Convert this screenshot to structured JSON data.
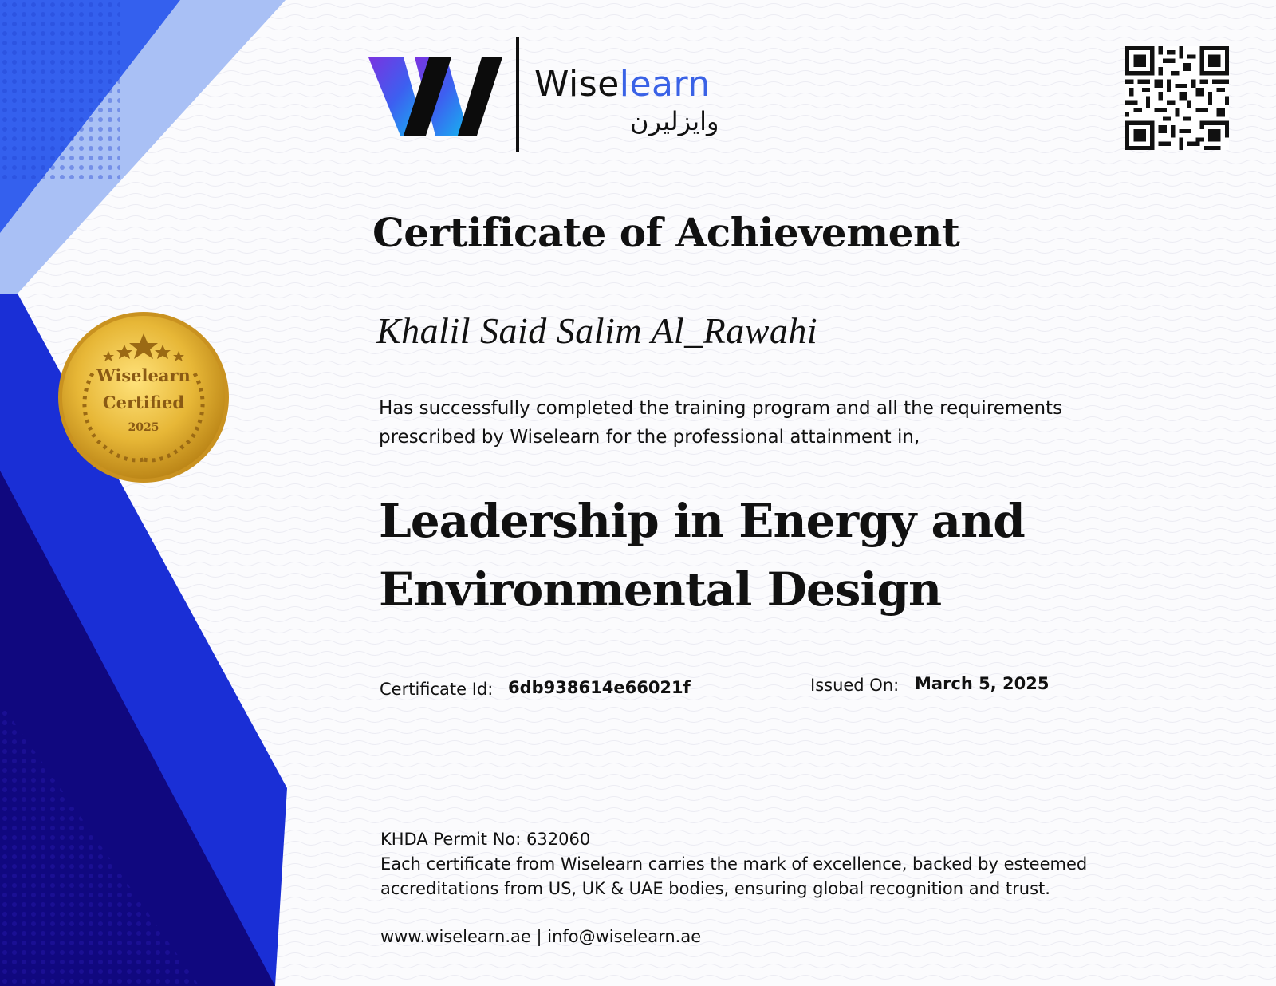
{
  "brand": {
    "name_part1": "Wise",
    "name_part2": "learn",
    "name_arabic": "وايزليرن"
  },
  "certificate": {
    "title": "Certificate of Achievement",
    "recipient": "Khalil Said Salim Al_Rawahi",
    "statement": "Has successfully completed the training program and all the requirements prescribed by Wiselearn for the professional attainment in,",
    "program_line1": "Leadership in Energy and",
    "program_line2": "Environmental Design",
    "id_label": "Certificate Id:",
    "id_value": "6db938614e66021f",
    "issued_label": "Issued On:",
    "issued_value": "March 5, 2025"
  },
  "seal": {
    "line1": "Wiselearn",
    "line2": "Certified",
    "year": "2025"
  },
  "footer": {
    "permit": "KHDA Permit No: 632060",
    "accreditation": "Each certificate from Wiselearn carries the mark of excellence, backed by esteemed accreditations from US, UK & UAE bodies, ensuring global recognition and trust.",
    "contact": "www.wiselearn.ae | info@wiselearn.ae"
  },
  "colors": {
    "accent_blue": "#3a62e6",
    "deep_navy": "#10087f",
    "royal_blue": "#1a2fd6",
    "light_blue": "#a9c0f5",
    "gold": "#d9a628"
  },
  "icons": [
    "logo-w-icon",
    "qr-code-icon",
    "star-icon",
    "laurel-icon"
  ]
}
